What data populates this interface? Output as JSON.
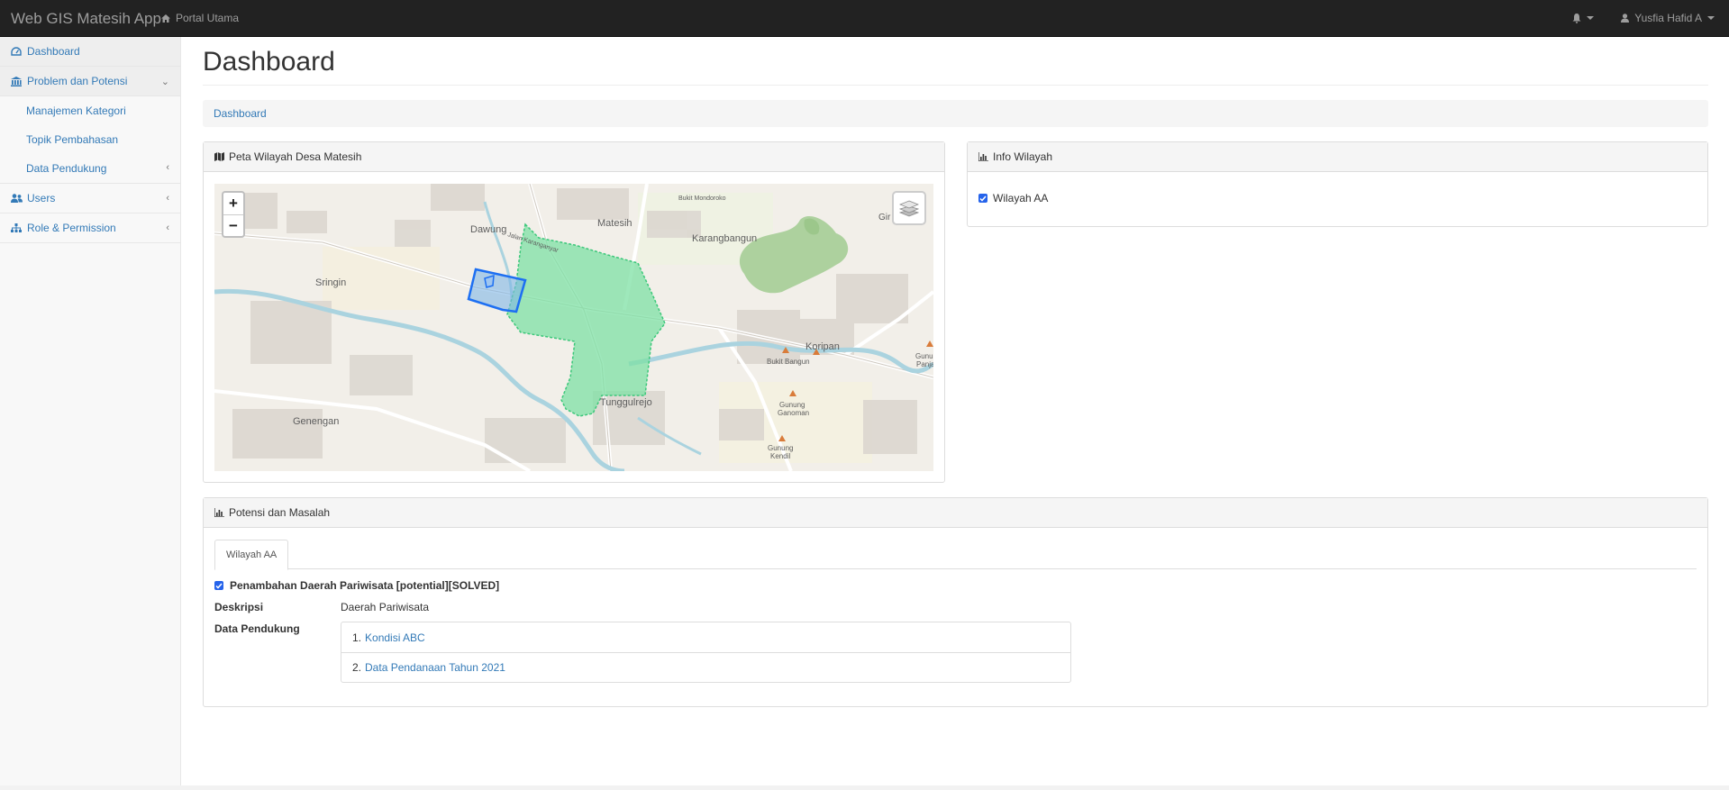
{
  "navbar": {
    "brand": "Web GIS Matesih App",
    "portal_link": "Portal Utama",
    "user_name": "Yusfia Hafid A"
  },
  "sidebar": {
    "items": [
      {
        "label": "Dashboard",
        "icon": "dashboard-icon"
      },
      {
        "label": "Problem dan Potensi",
        "icon": "bank-icon",
        "sub": [
          {
            "label": "Manajemen Kategori"
          },
          {
            "label": "Topik Pembahasan"
          },
          {
            "label": "Data Pendukung"
          }
        ]
      },
      {
        "label": "Users",
        "icon": "users-icon"
      },
      {
        "label": "Role & Permission",
        "icon": "sitemap-icon"
      }
    ]
  },
  "page": {
    "title": "Dashboard",
    "breadcrumb": "Dashboard"
  },
  "map_panel": {
    "title": "Peta Wilayah Desa Matesih",
    "zoom_in": "+",
    "zoom_out": "−",
    "labels": {
      "dawung": "Dawung",
      "matesih": "Matesih",
      "karangbangun": "Karangbangun",
      "sringin": "Sringin",
      "koripan": "Koripan",
      "bukit_bangun": "Bukit Bangun",
      "tunggulrejo": "Tunggulrejo",
      "gunung_ganoman_1": "Gunung",
      "gunung_ganoman_2": "Ganoman",
      "gunung_kendil_1": "Gunung",
      "gunung_kendil_2": "Kendil",
      "genengan": "Genengan",
      "jalan": "Jalan Karanganyar",
      "bukit_mondoroko": "Bukit Mondoroko",
      "gir": "Gir",
      "gunung_panjang_1": "Gunu",
      "gunung_panjang_2": "Panja"
    },
    "colors": {
      "region_fill": "#7ee0a4",
      "region_stroke": "#3cc77a",
      "parcel_stroke": "#1d6ff2"
    }
  },
  "info_panel": {
    "title": "Info Wilayah",
    "checkbox_label": "Wilayah AA",
    "checked": true
  },
  "potensi_panel": {
    "title": "Potensi dan Masalah",
    "tab": "Wilayah AA",
    "item_title": "Penambahan Daerah Pariwisata [potential][SOLVED]",
    "desc_label": "Deskripsi",
    "desc_value": "Daerah Pariwisata",
    "data_label": "Data Pendukung",
    "data_items": [
      {
        "num": "1.",
        "link": "Kondisi ABC"
      },
      {
        "num": "2.",
        "link": "Data Pendanaan Tahun 2021"
      }
    ]
  }
}
